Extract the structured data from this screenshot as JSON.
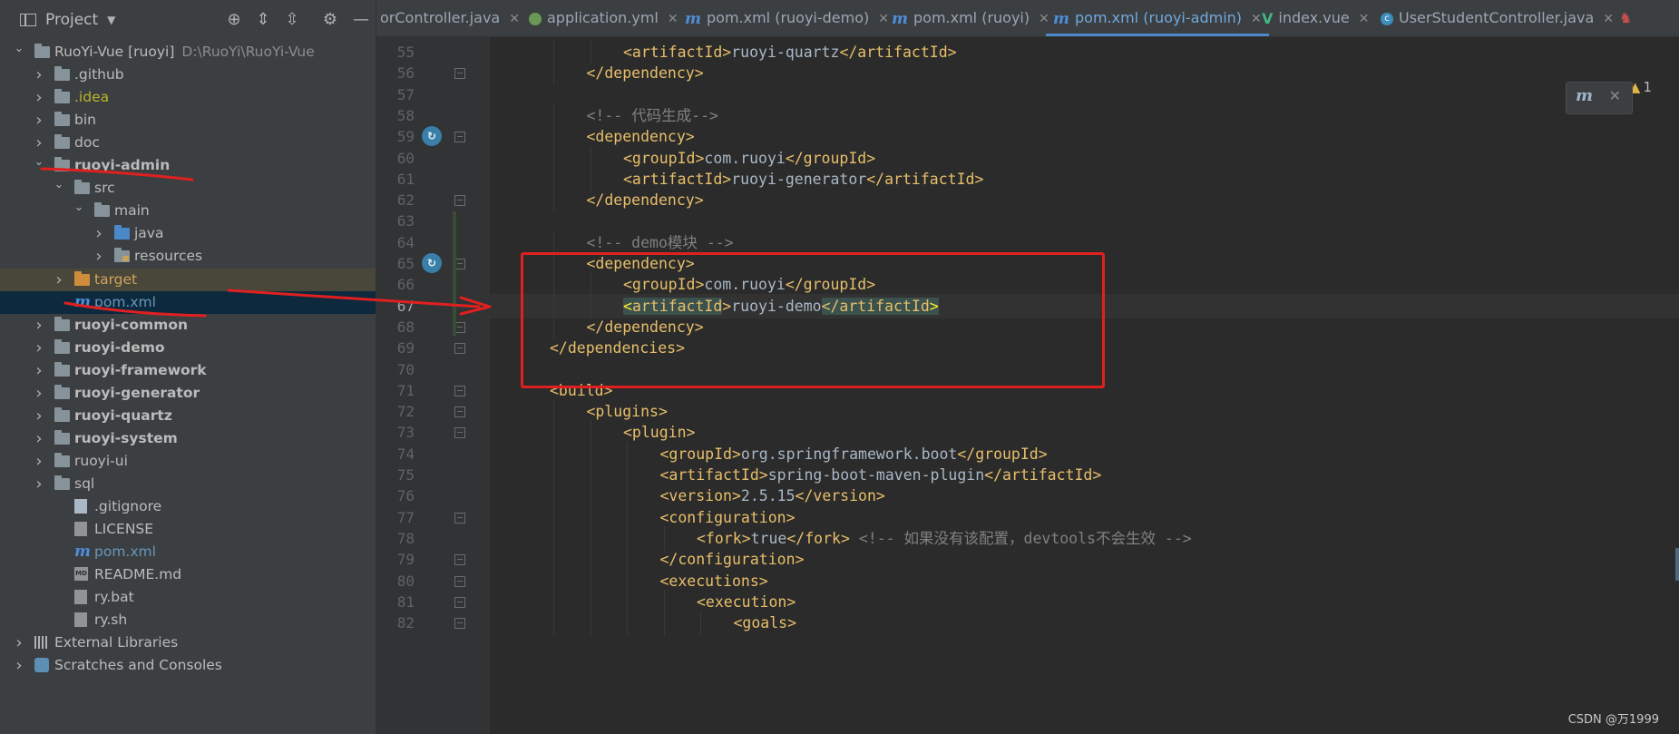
{
  "project_panel": {
    "title": "Project",
    "tree": [
      {
        "label": "RuoYi-Vue [ruoyi]",
        "path": "D:\\RuoYi\\RuoYi-Vue"
      },
      {
        "label": ".github"
      },
      {
        "label": ".idea"
      },
      {
        "label": "bin"
      },
      {
        "label": "doc"
      },
      {
        "label": "ruoyi-admin"
      },
      {
        "label": "src"
      },
      {
        "label": "main"
      },
      {
        "label": "java"
      },
      {
        "label": "resources"
      },
      {
        "label": "target"
      },
      {
        "label": "pom.xml"
      },
      {
        "label": "ruoyi-common"
      },
      {
        "label": "ruoyi-demo"
      },
      {
        "label": "ruoyi-framework"
      },
      {
        "label": "ruoyi-generator"
      },
      {
        "label": "ruoyi-quartz"
      },
      {
        "label": "ruoyi-system"
      },
      {
        "label": "ruoyi-ui"
      },
      {
        "label": "sql"
      },
      {
        "label": ".gitignore"
      },
      {
        "label": "LICENSE"
      },
      {
        "label": "pom.xml"
      },
      {
        "label": "README.md"
      },
      {
        "label": "ry.bat"
      },
      {
        "label": "ry.sh"
      },
      {
        "label": "External Libraries"
      },
      {
        "label": "Scratches and Consoles"
      }
    ]
  },
  "tabs": [
    {
      "label": "orController.java"
    },
    {
      "label": "application.yml"
    },
    {
      "label": "pom.xml (ruoyi-demo)"
    },
    {
      "label": "pom.xml (ruoyi)"
    },
    {
      "label": "pom.xml (ruoyi-admin)"
    },
    {
      "label": "index.vue"
    },
    {
      "label": "UserStudentController.java"
    }
  ],
  "editor": {
    "warning_count": "1",
    "current_line": 67,
    "lines": [
      {
        "n": "55",
        "indent": 2,
        "parts": [
          [
            "tag",
            "<artifactId>"
          ],
          [
            "txt",
            "ruoyi-quartz"
          ],
          [
            "tag",
            "</artifactId>"
          ]
        ]
      },
      {
        "n": "56",
        "indent": 1,
        "parts": [
          [
            "tag",
            "</dependency>"
          ]
        ]
      },
      {
        "n": "57",
        "indent": 0,
        "parts": []
      },
      {
        "n": "58",
        "indent": 1,
        "parts": [
          [
            "cm",
            "<!-- 代码生成-->"
          ]
        ]
      },
      {
        "n": "59",
        "indent": 1,
        "parts": [
          [
            "tag",
            "<dependency>"
          ]
        ]
      },
      {
        "n": "60",
        "indent": 2,
        "parts": [
          [
            "tag",
            "<groupId>"
          ],
          [
            "txt",
            "com.ruoyi"
          ],
          [
            "tag",
            "</groupId>"
          ]
        ]
      },
      {
        "n": "61",
        "indent": 2,
        "parts": [
          [
            "tag",
            "<artifactId>"
          ],
          [
            "txt",
            "ruoyi-generator"
          ],
          [
            "tag",
            "</artifactId>"
          ]
        ]
      },
      {
        "n": "62",
        "indent": 1,
        "parts": [
          [
            "tag",
            "</dependency>"
          ]
        ]
      },
      {
        "n": "63",
        "indent": 0,
        "parts": []
      },
      {
        "n": "64",
        "indent": 1,
        "parts": [
          [
            "cm",
            "<!-- demo模块 -->"
          ]
        ]
      },
      {
        "n": "65",
        "indent": 1,
        "parts": [
          [
            "tag",
            "<dependency>"
          ]
        ]
      },
      {
        "n": "66",
        "indent": 2,
        "parts": [
          [
            "tag",
            "<groupId>"
          ],
          [
            "txt",
            "com.ruoyi"
          ],
          [
            "tag",
            "</groupId>"
          ]
        ]
      },
      {
        "n": "67",
        "indent": 2,
        "parts": [
          [
            "caret",
            "<"
          ],
          [
            "hl",
            "artifactId"
          ],
          [
            "tag",
            ">"
          ],
          [
            "txt",
            "ruoyi-demo"
          ],
          [
            "hl",
            "</artifactId"
          ],
          [
            "caret",
            ">"
          ]
        ]
      },
      {
        "n": "68",
        "indent": 1,
        "parts": [
          [
            "tag",
            "</dependency>"
          ]
        ]
      },
      {
        "n": "69",
        "indent": 0,
        "parts": [
          [
            "tag",
            "</dependencies>"
          ]
        ]
      },
      {
        "n": "70",
        "indent": 0,
        "parts": []
      },
      {
        "n": "71",
        "indent": 0,
        "parts": [
          [
            "tag",
            "<build>"
          ]
        ]
      },
      {
        "n": "72",
        "indent": 1,
        "parts": [
          [
            "tag",
            "<plugins>"
          ]
        ]
      },
      {
        "n": "73",
        "indent": 2,
        "parts": [
          [
            "tag",
            "<plugin>"
          ]
        ]
      },
      {
        "n": "74",
        "indent": 3,
        "parts": [
          [
            "tag",
            "<groupId>"
          ],
          [
            "txt",
            "org.springframework.boot"
          ],
          [
            "tag",
            "</groupId>"
          ]
        ]
      },
      {
        "n": "75",
        "indent": 3,
        "parts": [
          [
            "tag",
            "<artifactId>"
          ],
          [
            "txt",
            "spring-boot-maven-plugin"
          ],
          [
            "tag",
            "</artifactId>"
          ]
        ]
      },
      {
        "n": "76",
        "indent": 3,
        "parts": [
          [
            "tag",
            "<version>"
          ],
          [
            "txt",
            "2.5.15"
          ],
          [
            "tag",
            "</version>"
          ]
        ]
      },
      {
        "n": "77",
        "indent": 3,
        "parts": [
          [
            "tag",
            "<configuration>"
          ]
        ]
      },
      {
        "n": "78",
        "indent": 4,
        "parts": [
          [
            "tag",
            "<fork>"
          ],
          [
            "txt",
            "true"
          ],
          [
            "tag",
            "</fork>"
          ],
          [
            "txt",
            " "
          ],
          [
            "cm",
            "<!-- 如果没有该配置，devtools不会生效 -->"
          ]
        ]
      },
      {
        "n": "79",
        "indent": 3,
        "parts": [
          [
            "tag",
            "</configuration>"
          ]
        ]
      },
      {
        "n": "80",
        "indent": 3,
        "parts": [
          [
            "tag",
            "<executions>"
          ]
        ]
      },
      {
        "n": "81",
        "indent": 4,
        "parts": [
          [
            "tag",
            "<execution>"
          ]
        ]
      },
      {
        "n": "82",
        "indent": 5,
        "parts": [
          [
            "tag",
            "<goals>"
          ]
        ]
      }
    ]
  },
  "watermark": "CSDN @万1999",
  "colors": {
    "annotation_red": "#e02020",
    "accent_blue": "#4a88c7"
  }
}
